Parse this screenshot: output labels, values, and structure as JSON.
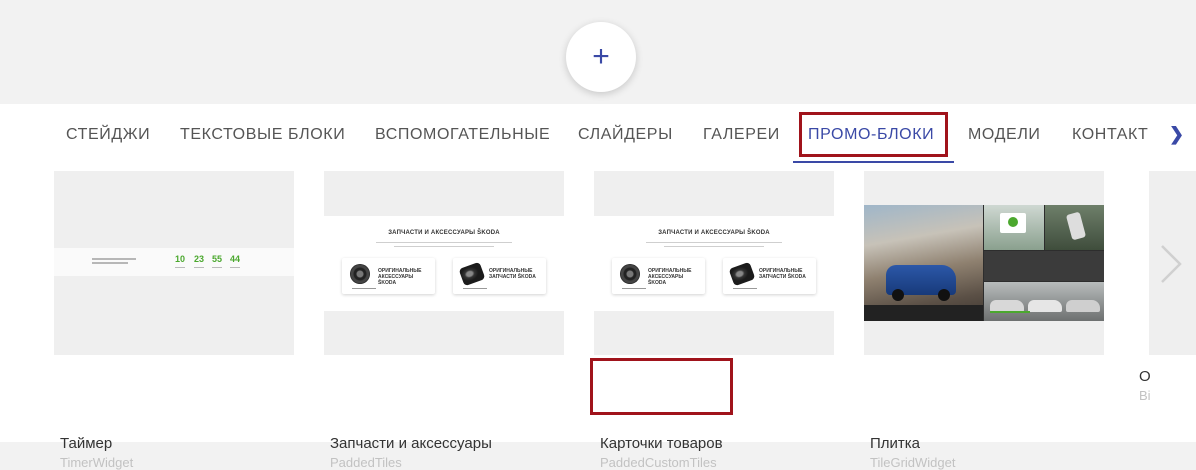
{
  "add_button": {
    "label": "+"
  },
  "tabs": [
    {
      "label": "СТЕЙДЖИ",
      "active": false
    },
    {
      "label": "ТЕКСТОВЫЕ БЛОКИ",
      "active": false
    },
    {
      "label": "ВСПОМОГАТЕЛЬНЫЕ",
      "active": false
    },
    {
      "label": "СЛАЙДЕРЫ",
      "active": false
    },
    {
      "label": "ГАЛЕРЕИ",
      "active": false
    },
    {
      "label": "ПРОМО-БЛОКИ",
      "active": true
    },
    {
      "label": "МОДЕЛИ",
      "active": false
    },
    {
      "label": "КОНТАКТ",
      "active": false
    }
  ],
  "tabs_next_icon": "chevron-right-icon",
  "cards": [
    {
      "title": "Таймер",
      "subtitle": "TimerWidget",
      "preview": {
        "label": "ДО ОКОНЧАНИЯ АКЦИИ ОСТАЛОСЬ",
        "values": [
          "10",
          "23",
          "55",
          "44"
        ]
      }
    },
    {
      "title": "Запчасти и аксессуары",
      "subtitle": "PaddedTiles",
      "preview": {
        "heading": "ЗАПЧАСТИ И АКСЕССУАРЫ ŠKODA",
        "tiles": [
          "ОРИГИНАЛЬНЫЕ АКСЕССУАРЫ ŠKODA",
          "ОРИГИНАЛЬНЫЕ ЗАПЧАСТИ ŠKODA"
        ]
      }
    },
    {
      "title": "Карточки товаров",
      "subtitle": "PaddedCustomTiles",
      "preview": {
        "heading": "ЗАПЧАСТИ И АКСЕССУАРЫ ŠKODA",
        "tiles": [
          "ОРИГИНАЛЬНЫЕ АКСЕССУАРЫ ŠKODA",
          "ОРИГИНАЛЬНЫЕ ЗАПЧАСТИ ŠKODA"
        ]
      }
    },
    {
      "title": "Плитка",
      "subtitle": "TileGridWidget",
      "preview": {}
    },
    {
      "title": "О",
      "subtitle": "Bi"
    }
  ],
  "carousel_next_icon": "chevron-right-icon",
  "colors": {
    "accent": "#3a49a6",
    "highlight": "#a0131b",
    "timer_green": "#4ba82e"
  }
}
